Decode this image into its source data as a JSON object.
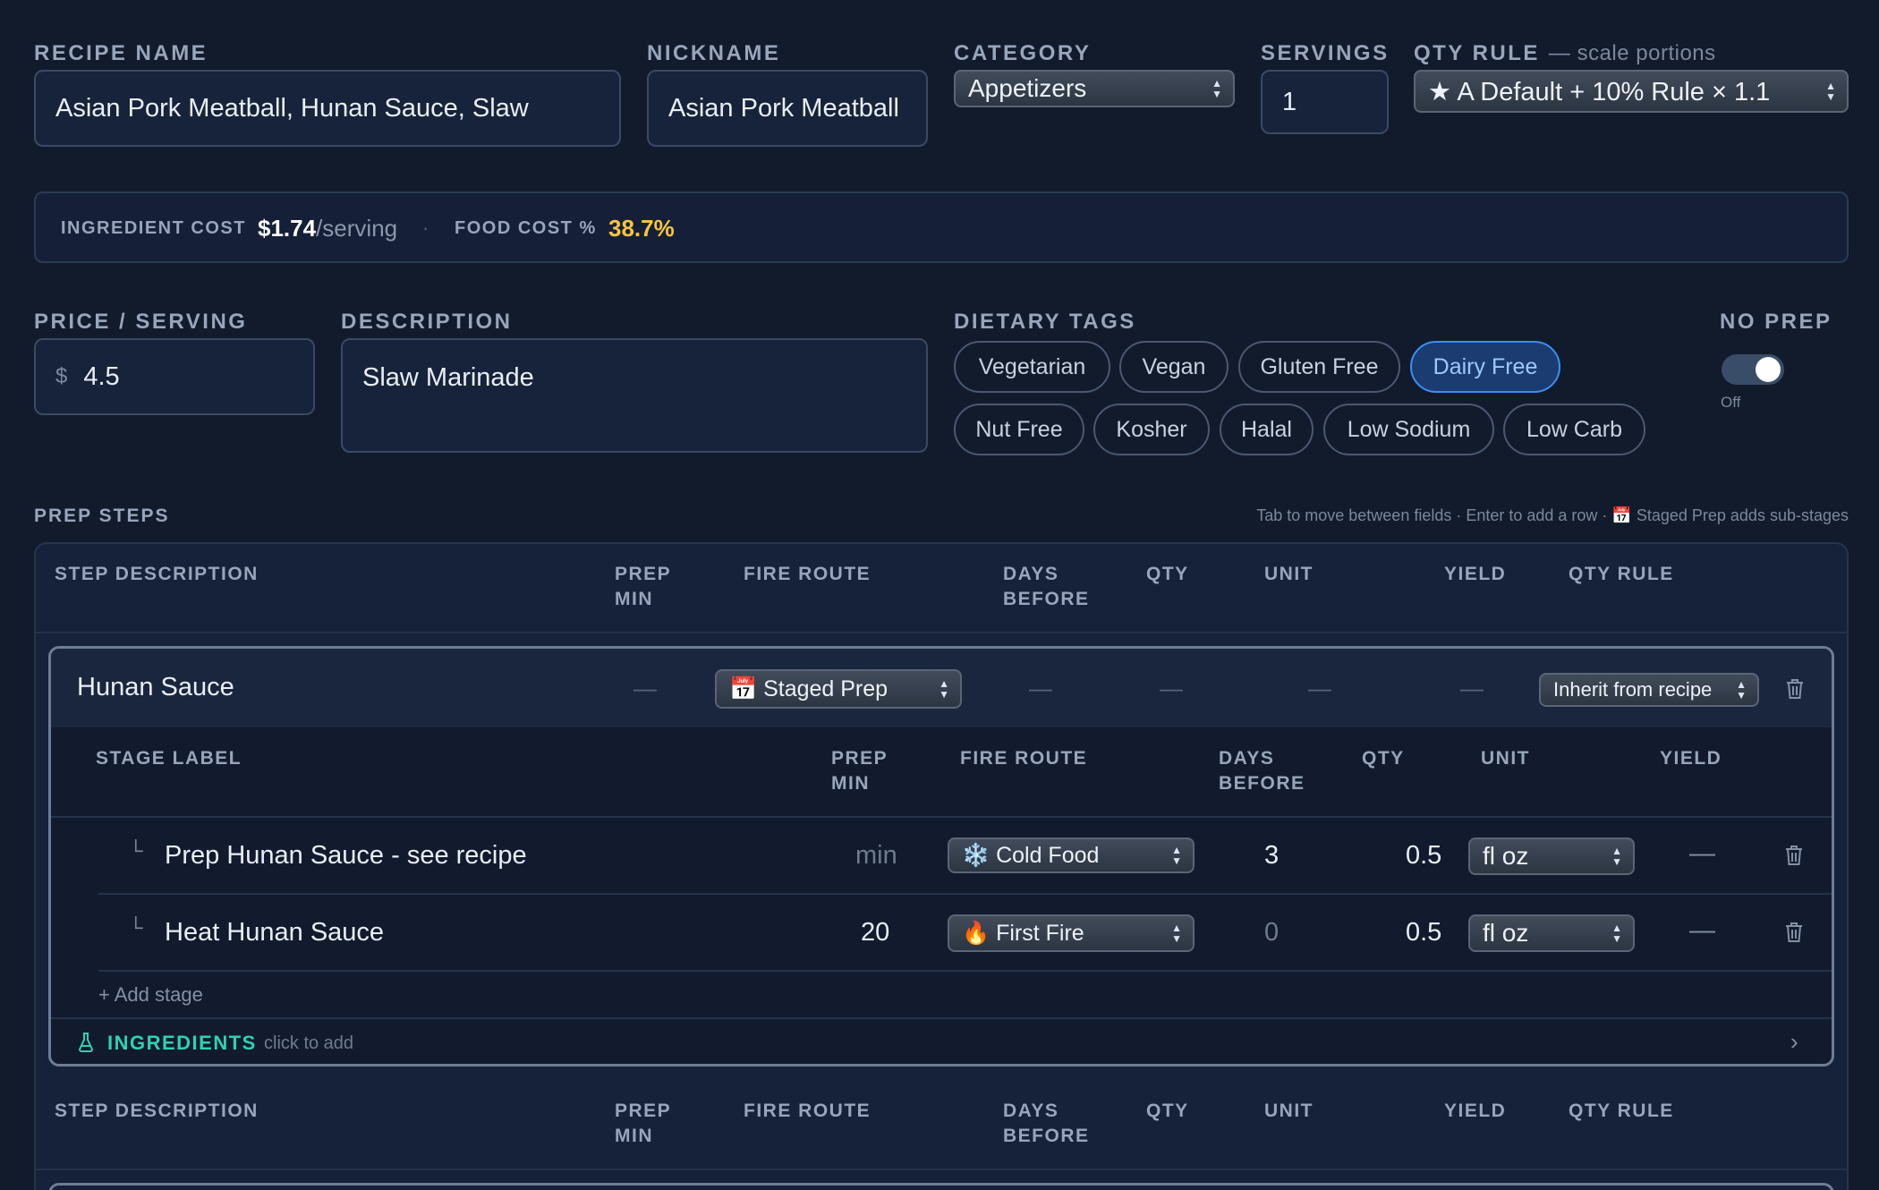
{
  "recipe": {
    "name_label": "RECIPE NAME",
    "name_value": "Asian Pork Meatball, Hunan Sauce, Slaw",
    "nickname_label": "NICKNAME",
    "nickname_value": "Asian Pork Meatball",
    "category_label": "CATEGORY",
    "category_value": "Appetizers",
    "servings_label": "SERVINGS",
    "servings_value": "1",
    "qty_rule_label": "QTY RULE",
    "qty_rule_note": "— scale portions",
    "qty_rule_value": "★ A Default + 10% Rule × 1.1"
  },
  "cost": {
    "ingredient_label": "INGREDIENT COST",
    "ingredient_value": "$1.74",
    "ingredient_unit": "/serving",
    "sep": "·",
    "food_label": "FOOD COST %",
    "food_value": "38.7%",
    "food_color": "#f5c542"
  },
  "pricing": {
    "price_label": "PRICE / SERVING",
    "currency": "$",
    "price_value": "4.5",
    "description_label": "DESCRIPTION",
    "description_value": "Slaw Marinade"
  },
  "dietary": {
    "label": "DIETARY TAGS",
    "tags": [
      {
        "label": "Vegetarian",
        "active": false
      },
      {
        "label": "Vegan",
        "active": false
      },
      {
        "label": "Gluten Free",
        "active": false
      },
      {
        "label": "Dairy Free",
        "active": true
      },
      {
        "label": "Nut Free",
        "active": false
      },
      {
        "label": "Kosher",
        "active": false
      },
      {
        "label": "Halal",
        "active": false
      },
      {
        "label": "Low Sodium",
        "active": false
      },
      {
        "label": "Low Carb",
        "active": false
      }
    ],
    "active_color": "#3d8ef2"
  },
  "no_prep": {
    "label": "NO PREP",
    "state_text": "Off"
  },
  "prep": {
    "label": "PREP STEPS",
    "help": "Tab to move between fields · Enter to add a row · 📅 Staged Prep adds sub-stages",
    "columns": {
      "step_description": "STEP DESCRIPTION",
      "prep": "PREP",
      "min": "MIN",
      "fire_route": "FIRE ROUTE",
      "days": "DAYS",
      "before": "BEFORE",
      "qty": "QTY",
      "unit": "UNIT",
      "yield": "YIELD",
      "qty_rule": "QTY RULE"
    },
    "steps": [
      {
        "name": "Hunan Sauce",
        "placeholder": "—",
        "fire_route": "📅 Staged Prep",
        "qty_rule": "Inherit from recipe",
        "stage_columns": {
          "stage_label": "STAGE LABEL",
          "prep": "PREP",
          "min": "MIN",
          "fire_route": "FIRE ROUTE",
          "days": "DAYS",
          "before": "BEFORE",
          "qty": "QTY",
          "unit": "UNIT",
          "yield": "YIELD"
        },
        "stages": [
          {
            "corner": "└",
            "label": "Prep Hunan Sauce - see recipe",
            "prep_min": "min",
            "fire_route": "❄️ Cold Food",
            "days_before": "3",
            "qty": "0.5",
            "unit": "fl oz",
            "yield": "—"
          },
          {
            "corner": "└",
            "label": "Heat Hunan Sauce",
            "prep_min": "20",
            "fire_route": "🔥 First Fire",
            "days_before": "0",
            "qty": "0.5",
            "unit": "fl oz",
            "yield": "—"
          }
        ],
        "add_stage": "+ Add stage",
        "ingredients_label": "INGREDIENTS",
        "ingredients_hint": "click to add",
        "chevron": "›"
      }
    ]
  }
}
